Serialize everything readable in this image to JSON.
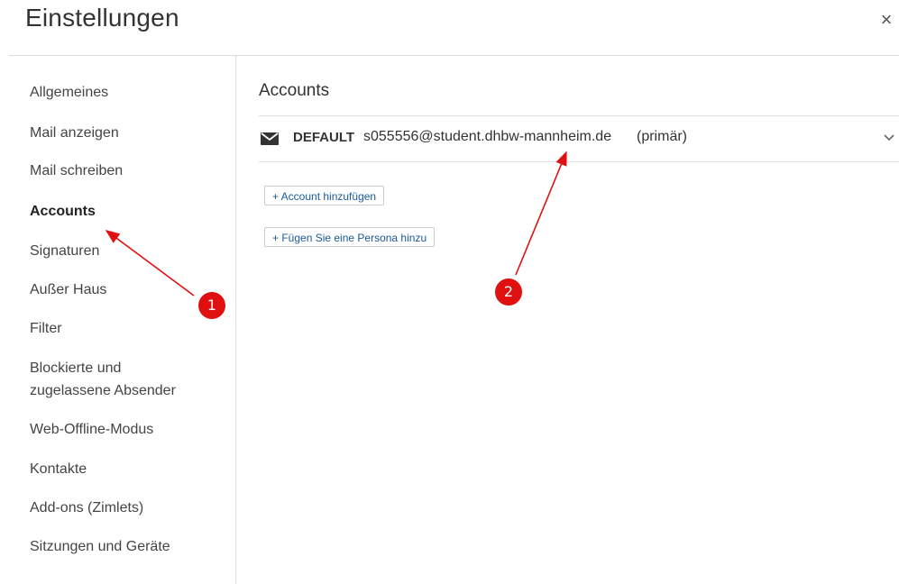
{
  "header": {
    "title": "Einstellungen",
    "close_symbol": "×"
  },
  "sidebar": {
    "items": [
      {
        "label": "Allgemeines"
      },
      {
        "label": "Mail anzeigen"
      },
      {
        "label": "Mail schreiben"
      },
      {
        "label": "Accounts",
        "active": true
      },
      {
        "label": "Signaturen"
      },
      {
        "label": "Außer Haus"
      },
      {
        "label": "Filter"
      },
      {
        "label": "Blockierte und"
      },
      {
        "label": "zugelassene Absender"
      },
      {
        "label": "Web-Offline-Modus"
      },
      {
        "label": "Kontakte"
      },
      {
        "label": "Add-ons (Zimlets)"
      },
      {
        "label": "Sitzungen und Geräte"
      }
    ]
  },
  "main": {
    "section_title": "Accounts",
    "account": {
      "icon": "mail-icon",
      "name": "DEFAULT",
      "email": "s055556@student.dhbw-mannheim.de",
      "tag": "(primär)",
      "expand_icon": "chevron-down-icon"
    },
    "buttons": {
      "add_account": "+ Account hinzufügen",
      "add_persona": "+ Fügen Sie eine Persona hinzu"
    }
  },
  "annotations": {
    "color": "#e01010",
    "markers": [
      {
        "label": "1"
      },
      {
        "label": "2"
      }
    ]
  }
}
